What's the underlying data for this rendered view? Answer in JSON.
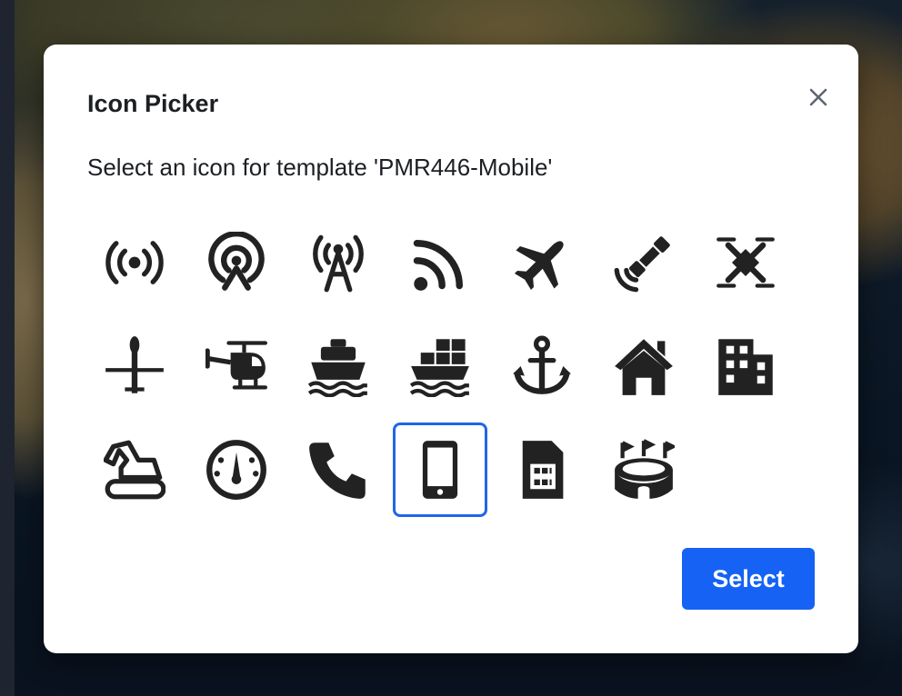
{
  "dialog": {
    "title": "Icon Picker",
    "subtitle": "Select an icon for template 'PMR446-Mobile'",
    "close_icon": "close-icon",
    "select_label": "Select",
    "accent_color": "#1562f4",
    "selected_border_color": "#1f66e5"
  },
  "icons": [
    {
      "name": "broadcast-icon"
    },
    {
      "name": "podcast-tower-icon"
    },
    {
      "name": "radio-tower-icon"
    },
    {
      "name": "rss-icon"
    },
    {
      "name": "airplane-icon"
    },
    {
      "name": "satellite-dish-icon"
    },
    {
      "name": "drone-icon"
    },
    {
      "name": "plane-topview-icon"
    },
    {
      "name": "helicopter-icon"
    },
    {
      "name": "ship-icon"
    },
    {
      "name": "cargo-ship-icon"
    },
    {
      "name": "anchor-icon"
    },
    {
      "name": "house-icon"
    },
    {
      "name": "building-icon"
    },
    {
      "name": "excavator-icon"
    },
    {
      "name": "gauge-icon"
    },
    {
      "name": "phone-icon"
    },
    {
      "name": "mobile-phone-icon",
      "selected": true
    },
    {
      "name": "sim-card-icon"
    },
    {
      "name": "stadium-icon"
    }
  ]
}
